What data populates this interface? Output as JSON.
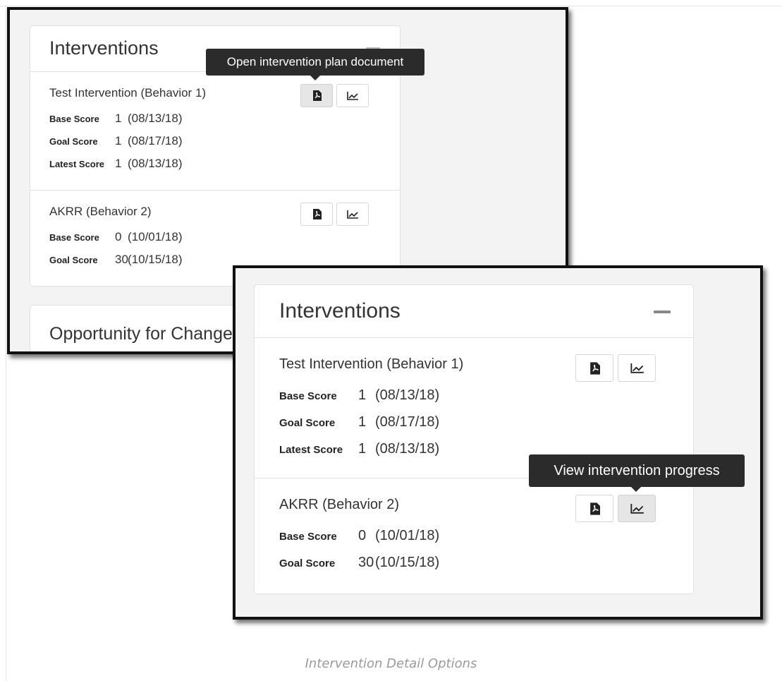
{
  "screens": [
    {
      "panel_title": "Interventions",
      "tooltip": "Open intervention plan document",
      "interventions": [
        {
          "name": "Test Intervention (Behavior 1)",
          "scores": [
            {
              "label": "Base Score",
              "value": "1",
              "date": "(08/13/18)"
            },
            {
              "label": "Goal Score",
              "value": "1",
              "date": "(08/17/18)"
            },
            {
              "label": "Latest Score",
              "value": "1",
              "date": "(08/13/18)"
            }
          ]
        },
        {
          "name": "AKRR (Behavior 2)",
          "scores": [
            {
              "label": "Base Score",
              "value": "0",
              "date": "(10/01/18)"
            },
            {
              "label": "Goal Score",
              "value": "30",
              "date": "(10/15/18)"
            }
          ]
        }
      ],
      "next_section_title": "Opportunity for Change"
    },
    {
      "panel_title": "Interventions",
      "tooltip": "View intervention progress",
      "interventions": [
        {
          "name": "Test Intervention (Behavior 1)",
          "scores": [
            {
              "label": "Base Score",
              "value": "1",
              "date": "(08/13/18)"
            },
            {
              "label": "Goal Score",
              "value": "1",
              "date": "(08/17/18)"
            },
            {
              "label": "Latest Score",
              "value": "1",
              "date": "(08/13/18)"
            }
          ]
        },
        {
          "name": "AKRR (Behavior 2)",
          "scores": [
            {
              "label": "Base Score",
              "value": "0",
              "date": "(10/01/18)"
            },
            {
              "label": "Goal Score",
              "value": "30",
              "date": "(10/15/18)"
            }
          ]
        }
      ]
    }
  ],
  "icons": {
    "document_button": "pdf-document-icon",
    "progress_button": "line-chart-icon",
    "collapse_button": "minus-icon"
  },
  "caption": "Intervention Detail Options"
}
